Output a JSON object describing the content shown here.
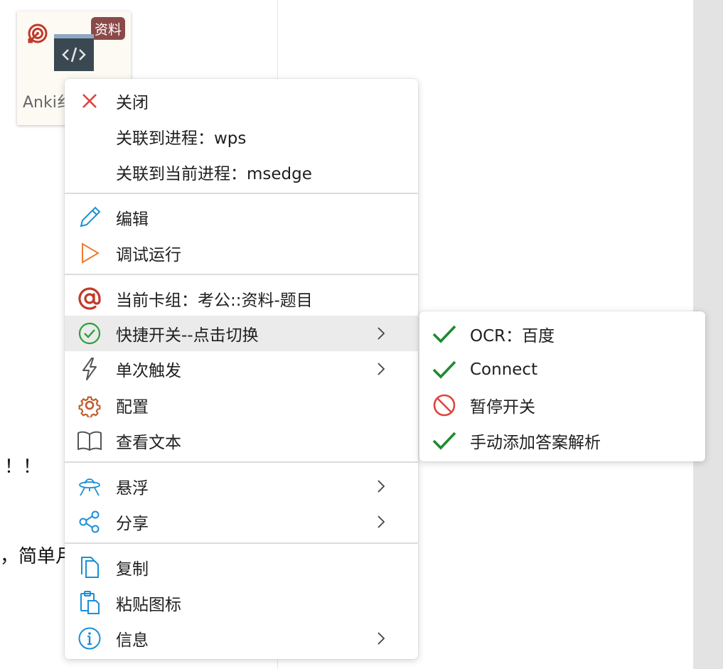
{
  "colors": {
    "accent_blue": "#1a8fd6",
    "close_red": "#e0443e",
    "play_orange": "#f07a32",
    "at_red": "#c0392b",
    "check_green": "#2e9e3e",
    "gear_brown": "#c15a2b",
    "badge_bg": "#8b4a4a"
  },
  "tile": {
    "badge": "资料",
    "label": "Anki纟",
    "icon": "code-window-icon"
  },
  "background": {
    "fragment_1": "！！",
    "fragment_2": "，简单月"
  },
  "context_menu": {
    "items": [
      {
        "label": "关闭",
        "icon": "close-icon"
      },
      {
        "label": "关联到进程：wps",
        "icon": ""
      },
      {
        "label": "关联到当前进程：msedge",
        "icon": ""
      },
      {
        "label": "编辑",
        "icon": "pencil-icon"
      },
      {
        "label": "调试运行",
        "icon": "play-icon"
      },
      {
        "label": "当前卡组：考公::资料-题目",
        "icon": "at-icon"
      },
      {
        "label": "快捷开关--点击切换",
        "icon": "check-circle-icon",
        "submenu": true,
        "highlighted": true
      },
      {
        "label": "单次触发",
        "icon": "lightning-icon",
        "submenu": true
      },
      {
        "label": "配置",
        "icon": "gear-icon"
      },
      {
        "label": "查看文本",
        "icon": "book-icon"
      },
      {
        "label": "悬浮",
        "icon": "ufo-icon",
        "submenu": true
      },
      {
        "label": "分享",
        "icon": "share-icon",
        "submenu": true
      },
      {
        "label": "复制",
        "icon": "copy-icon"
      },
      {
        "label": "粘贴图标",
        "icon": "paste-icon"
      },
      {
        "label": "信息",
        "icon": "info-icon",
        "submenu": true
      }
    ]
  },
  "submenu": {
    "items": [
      {
        "label": "OCR：百度",
        "icon": "checkmark-icon",
        "state": "on"
      },
      {
        "label": "Connect",
        "icon": "checkmark-icon",
        "state": "on"
      },
      {
        "label": "暂停开关",
        "icon": "prohibited-icon",
        "state": "off"
      },
      {
        "label": "手动添加答案解析",
        "icon": "checkmark-icon",
        "state": "on"
      }
    ]
  }
}
